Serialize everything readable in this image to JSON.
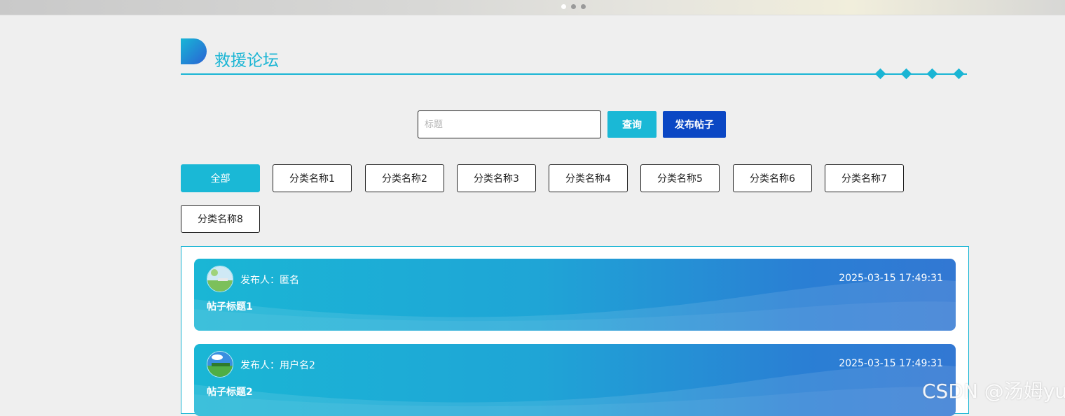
{
  "banner": {
    "indicator_count": 3,
    "active_index": 0
  },
  "section": {
    "title": "救援论坛"
  },
  "search": {
    "placeholder": "标题",
    "value": "",
    "query_label": "查询",
    "publish_label": "发布帖子"
  },
  "categories": [
    {
      "label": "全部",
      "active": true
    },
    {
      "label": "分类名称1",
      "active": false
    },
    {
      "label": "分类名称2",
      "active": false
    },
    {
      "label": "分类名称3",
      "active": false
    },
    {
      "label": "分类名称4",
      "active": false
    },
    {
      "label": "分类名称5",
      "active": false
    },
    {
      "label": "分类名称6",
      "active": false
    },
    {
      "label": "分类名称7",
      "active": false
    },
    {
      "label": "分类名称8",
      "active": false
    }
  ],
  "posts": [
    {
      "author_prefix": "发布人：",
      "author": "匿名",
      "time": "2025-03-15 17:49:31",
      "title": "帖子标题1"
    },
    {
      "author_prefix": "发布人：",
      "author": "用户名2",
      "time": "2025-03-15 17:49:31",
      "title": "帖子标题2"
    }
  ],
  "colors": {
    "accent": "#1ab8d6",
    "primary": "#0b47c4"
  },
  "watermark": "CSDN @汤姆yu"
}
